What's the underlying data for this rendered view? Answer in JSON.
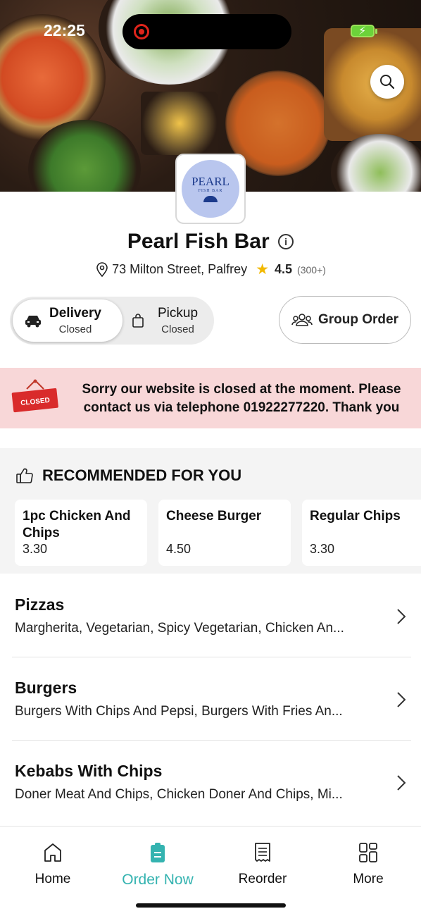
{
  "status_bar": {
    "time": "22:25"
  },
  "hero": {
    "search_icon": "search-icon"
  },
  "restaurant": {
    "logo_text_main": "PEARL",
    "logo_text_sub": "FISH BAR",
    "name": "Pearl Fish Bar",
    "address": "73 Milton Street, Palfrey",
    "rating": "4.5",
    "rating_count": "(300+)"
  },
  "order_mode": {
    "delivery_label": "Delivery",
    "delivery_status": "Closed",
    "pickup_label": "Pickup",
    "pickup_status": "Closed",
    "selected": "delivery"
  },
  "group_order": {
    "label": "Group Order"
  },
  "closed_banner": {
    "sign_text": "CLOSED",
    "message": "Sorry our website is closed at the moment. Please contact us via telephone 01922277220. Thank you"
  },
  "recommended": {
    "heading": "RECOMMENDED FOR YOU",
    "items": [
      {
        "name": "1pc Chicken And Chips",
        "price": "3.30"
      },
      {
        "name": "Cheese Burger",
        "price": "4.50"
      },
      {
        "name": "Regular Chips",
        "price": "3.30"
      }
    ]
  },
  "categories": [
    {
      "name": "Pizzas",
      "items": "Margherita, Vegetarian, Spicy Vegetarian, Chicken An..."
    },
    {
      "name": "Burgers",
      "items": "Burgers With Chips And Pepsi, Burgers With Fries An..."
    },
    {
      "name": "Kebabs With Chips",
      "items": "Doner Meat And Chips, Chicken Doner And Chips, Mi..."
    }
  ],
  "bottom_nav": {
    "items": [
      {
        "label": "Home",
        "icon": "home-icon"
      },
      {
        "label": "Order Now",
        "icon": "order-icon"
      },
      {
        "label": "Reorder",
        "icon": "receipt-icon"
      },
      {
        "label": "More",
        "icon": "grid-icon"
      }
    ],
    "active_color": "#34b3b0"
  }
}
